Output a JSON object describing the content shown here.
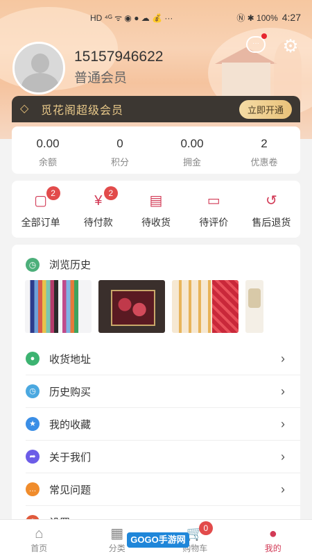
{
  "status_bar": {
    "left_icons": "HD ⁴ᴳ ᯤ ◉ ● ☁ 💰 ···",
    "right_text": "Ⓝ ✱ 100%",
    "time": "4:27"
  },
  "profile": {
    "phone": "15157946622",
    "member_level": "普通会员"
  },
  "vip": {
    "title": "觅花阁超级会员",
    "button": "立即开通"
  },
  "stats": [
    {
      "value": "0.00",
      "label": "余额"
    },
    {
      "value": "0",
      "label": "积分"
    },
    {
      "value": "0.00",
      "label": "拥金"
    },
    {
      "value": "2",
      "label": "优惠卷"
    }
  ],
  "orders": [
    {
      "label": "全部订单",
      "badge": "2",
      "icon": "order-list-icon"
    },
    {
      "label": "待付款",
      "badge": "2",
      "icon": "payment-icon"
    },
    {
      "label": "待收货",
      "badge": "",
      "icon": "delivery-box-icon"
    },
    {
      "label": "待评价",
      "badge": "",
      "icon": "comment-icon"
    },
    {
      "label": "售后退货",
      "badge": "",
      "icon": "refund-icon"
    }
  ],
  "history": {
    "title": "浏览历史"
  },
  "menu": [
    {
      "label": "收货地址",
      "color": "#3cb371",
      "icon": "location-icon"
    },
    {
      "label": "历史购买",
      "color": "#4aa8e0",
      "icon": "clock-icon"
    },
    {
      "label": "我的收藏",
      "color": "#3a8ee6",
      "icon": "star-icon"
    },
    {
      "label": "关于我们",
      "color": "#6c5ce7",
      "icon": "share-icon"
    },
    {
      "label": "常见问题",
      "color": "#f08c2c",
      "icon": "chat-icon"
    },
    {
      "label": "设置",
      "color": "#e05a3c",
      "icon": "settings-icon"
    }
  ],
  "nav": [
    {
      "label": "首页",
      "icon": "home-icon"
    },
    {
      "label": "分类",
      "icon": "grid-icon"
    },
    {
      "label": "购物车",
      "icon": "cart-icon",
      "badge": "0"
    },
    {
      "label": "我的",
      "icon": "user-icon"
    }
  ],
  "watermark": "GOGO手游网",
  "colors": {
    "accent": "#d23a56",
    "vip_bg": "#3c3732",
    "vip_gold": "#e9c98a",
    "badge": "#e24b4b"
  }
}
